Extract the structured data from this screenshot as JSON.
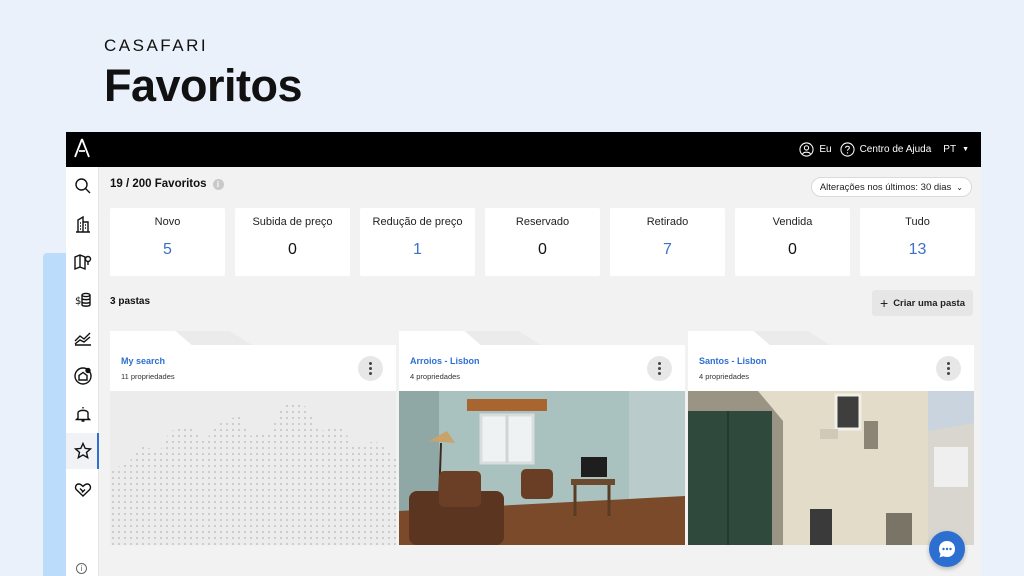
{
  "brand": {
    "wordmark": "CASAFARI",
    "headline": "Favoritos"
  },
  "topbar": {
    "user_label": "Eu",
    "help_label": "Centro de Ajuda",
    "language": "PT"
  },
  "sidebar": {
    "items": [
      {
        "icon": "search-icon"
      },
      {
        "icon": "building-icon"
      },
      {
        "icon": "map-pin-icon"
      },
      {
        "icon": "coins-icon"
      },
      {
        "icon": "chart-icon"
      },
      {
        "icon": "home-circle-icon"
      },
      {
        "icon": "bell-icon"
      },
      {
        "icon": "star-icon",
        "active": true
      },
      {
        "icon": "handshake-icon"
      }
    ]
  },
  "favorites": {
    "count_label": "19 / 200 Favoritos",
    "period_select": "Alterações nos últimos: 30 dias"
  },
  "stats": [
    {
      "label": "Novo",
      "value": "5",
      "color": "#3b72c9"
    },
    {
      "label": "Subida de preço",
      "value": "0",
      "color": "#111111"
    },
    {
      "label": "Redução de preço",
      "value": "1",
      "color": "#3b72c9"
    },
    {
      "label": "Reservado",
      "value": "0",
      "color": "#111111"
    },
    {
      "label": "Retirado",
      "value": "7",
      "color": "#3b72c9"
    },
    {
      "label": "Vendida",
      "value": "0",
      "color": "#111111"
    },
    {
      "label": "Tudo",
      "value": "13",
      "color": "#3b72c9"
    }
  ],
  "folders_section": {
    "title": "3 pastas",
    "create_label": "Criar uma pasta"
  },
  "folders": [
    {
      "name": "My search",
      "count": "11 propriedades"
    },
    {
      "name": "Arroios - Lisbon",
      "count": "4 propriedades"
    },
    {
      "name": "Santos - Lisbon",
      "count": "4 propriedades"
    }
  ],
  "colors": {
    "accent": "#2f6fd0",
    "topbar": "#000000",
    "page_bg": "#eaf1fb"
  }
}
